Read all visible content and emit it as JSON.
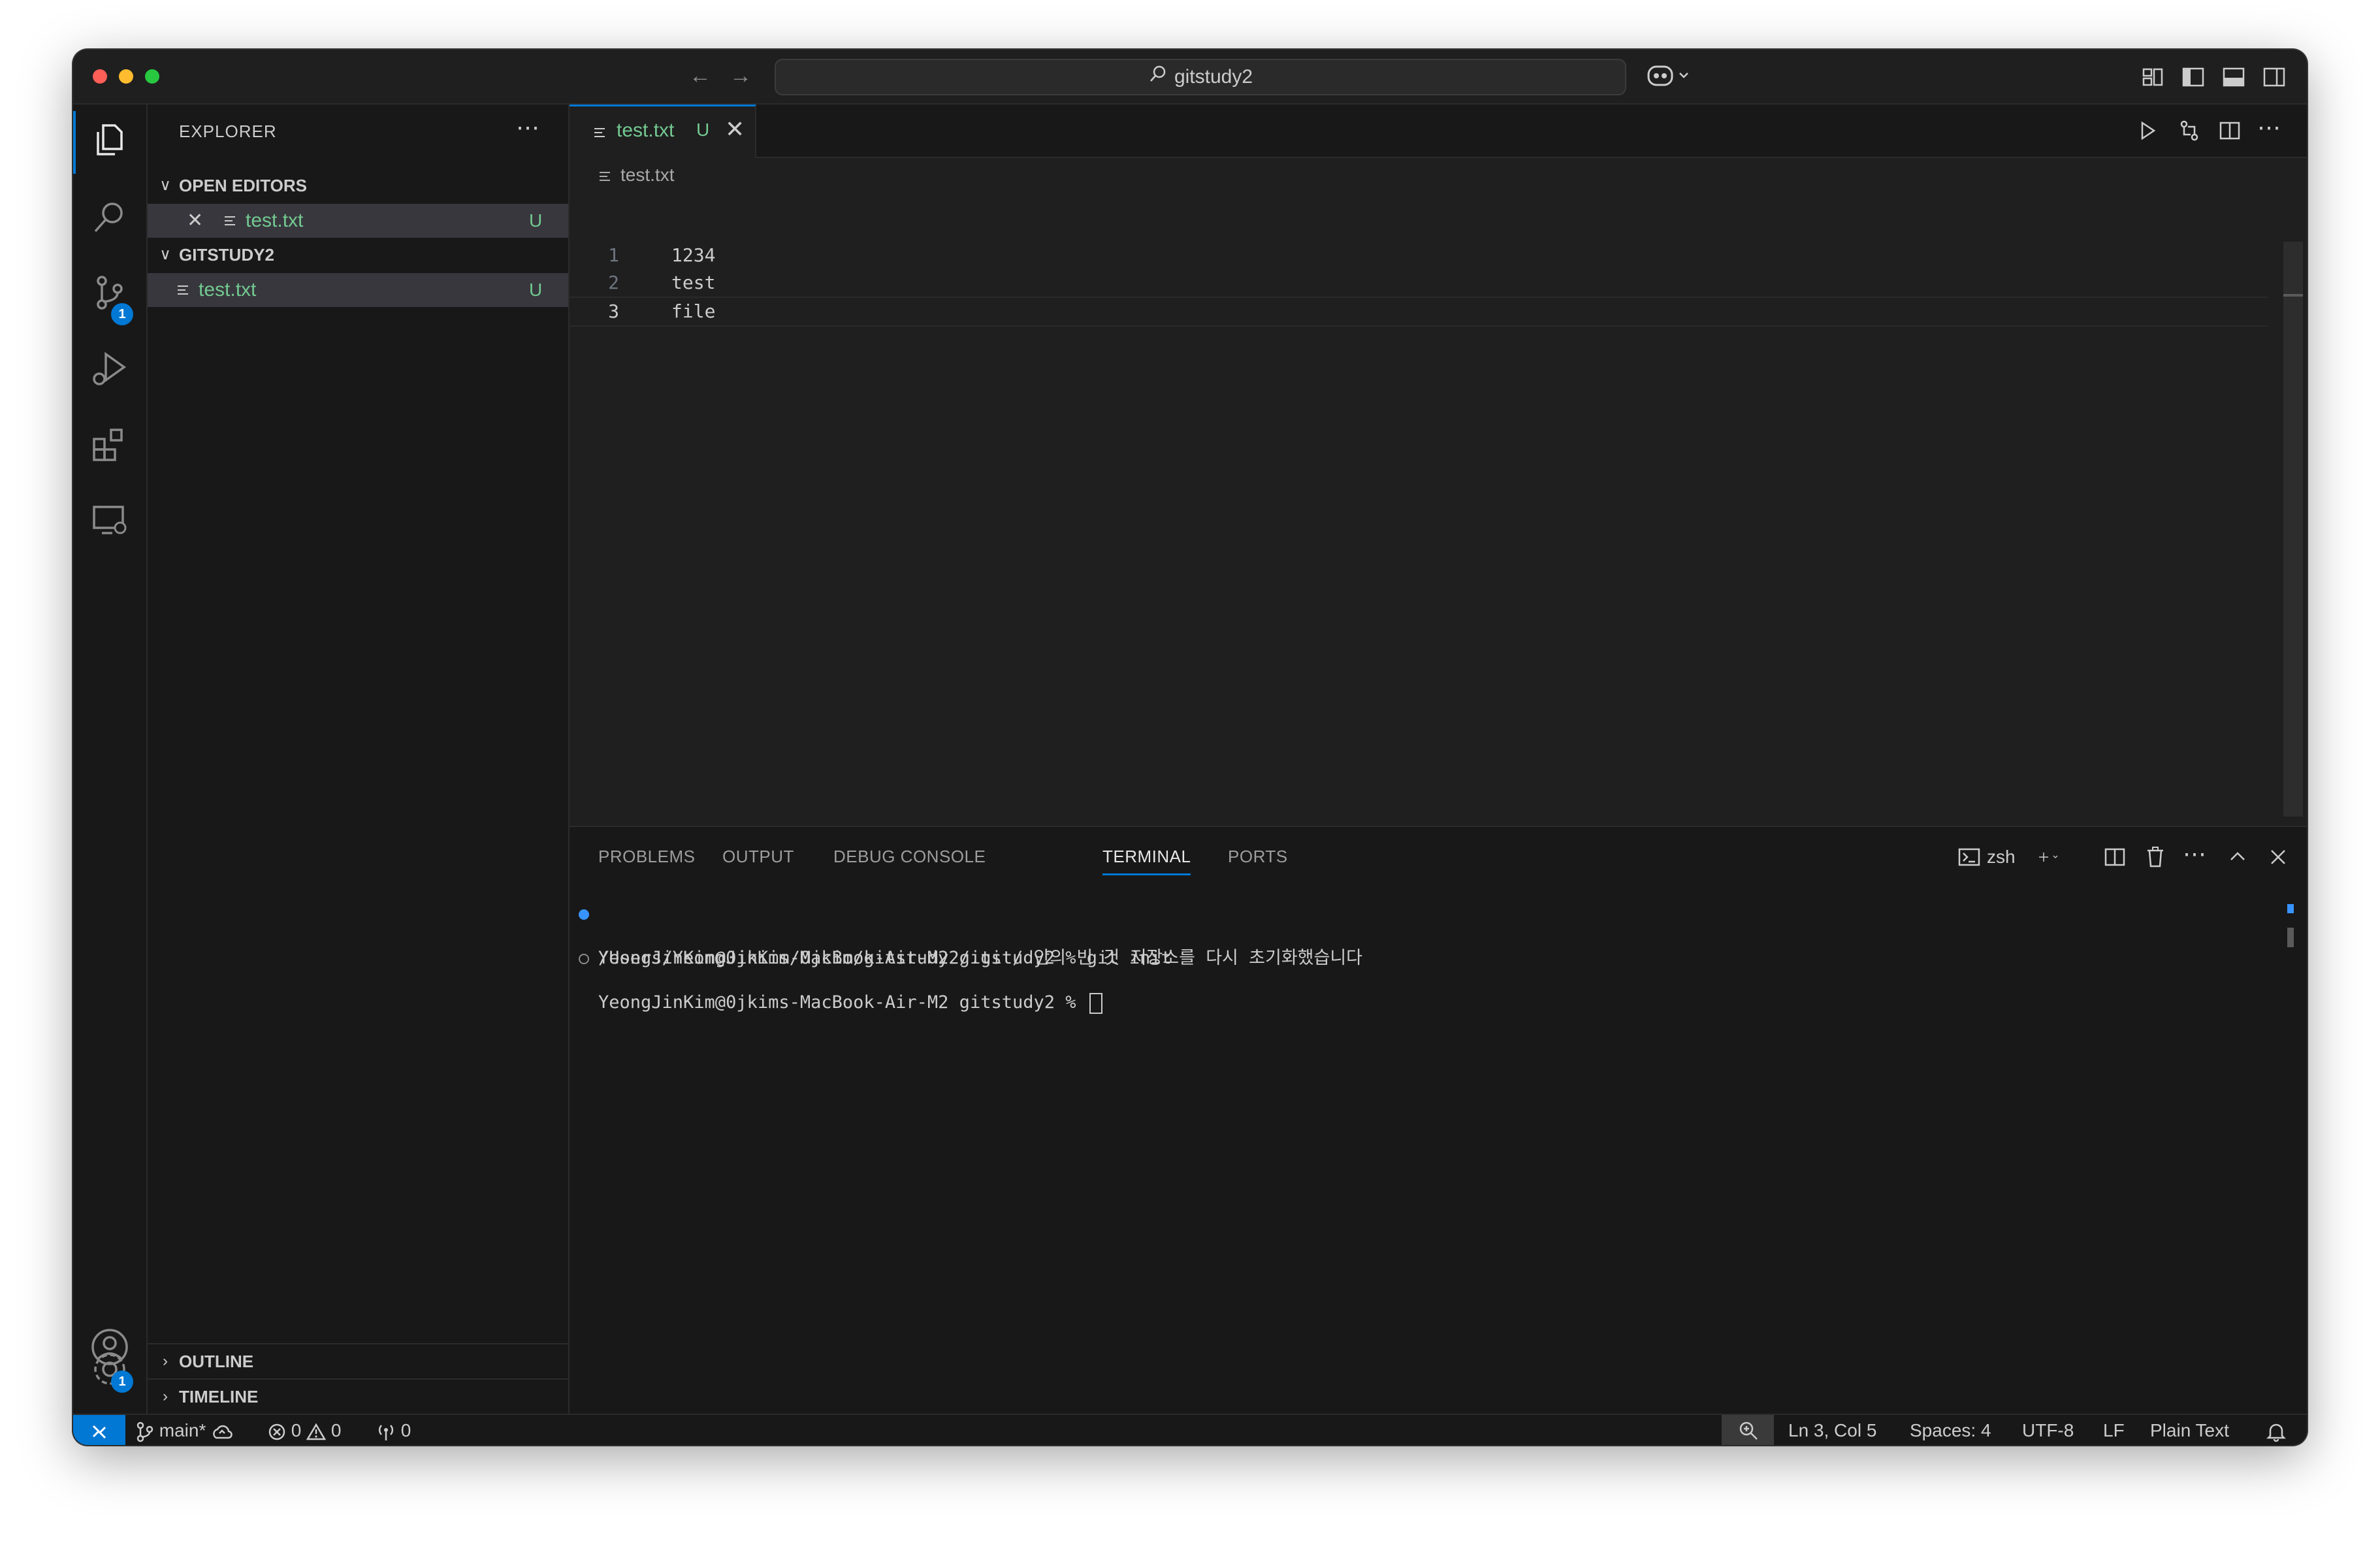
{
  "titlebar": {
    "search_text": "gitstudy2"
  },
  "activity_bar": {
    "scm_badge": "1",
    "settings_badge": "1"
  },
  "sidebar": {
    "title": "EXPLORER",
    "open_editors": {
      "label": "OPEN EDITORS",
      "files": [
        {
          "name": "test.txt",
          "status": "U"
        }
      ]
    },
    "folder": {
      "label": "GITSTUDY2",
      "files": [
        {
          "name": "test.txt",
          "status": "U"
        }
      ]
    },
    "outline_label": "OUTLINE",
    "timeline_label": "TIMELINE"
  },
  "editor": {
    "tab": {
      "name": "test.txt",
      "status": "U"
    },
    "breadcrumb": "test.txt",
    "lines": [
      {
        "number": "1",
        "text": "1234"
      },
      {
        "number": "2",
        "text": "test"
      },
      {
        "number": "3",
        "text": "file"
      }
    ],
    "current_line": 3
  },
  "panel": {
    "tabs": [
      "PROBLEMS",
      "OUTPUT",
      "DEBUG CONSOLE",
      "TERMINAL",
      "PORTS"
    ],
    "active_tab": "TERMINAL",
    "shell": "zsh",
    "terminal_lines": [
      "YeongJinKim@0jkims-MacBook-Air-M2 gitstudy2 % git init",
      "/Users/YeongJinKim/0jkim/gitstudy2/.git/ 안의 빈 깃 저장소를 다시 초기화했습니다",
      "YeongJinKim@0jkims-MacBook-Air-M2 gitstudy2 % "
    ]
  },
  "statusbar": {
    "branch": "main*",
    "errors": "0",
    "warnings": "0",
    "ports": "0",
    "position": "Ln 3, Col 5",
    "spaces": "Spaces: 4",
    "encoding": "UTF-8",
    "eol": "LF",
    "language": "Plain Text"
  },
  "colors": {
    "accent": "#0078d4",
    "untracked": "#73c991",
    "background": "#181818",
    "editor_bg": "#1f1f1f"
  }
}
